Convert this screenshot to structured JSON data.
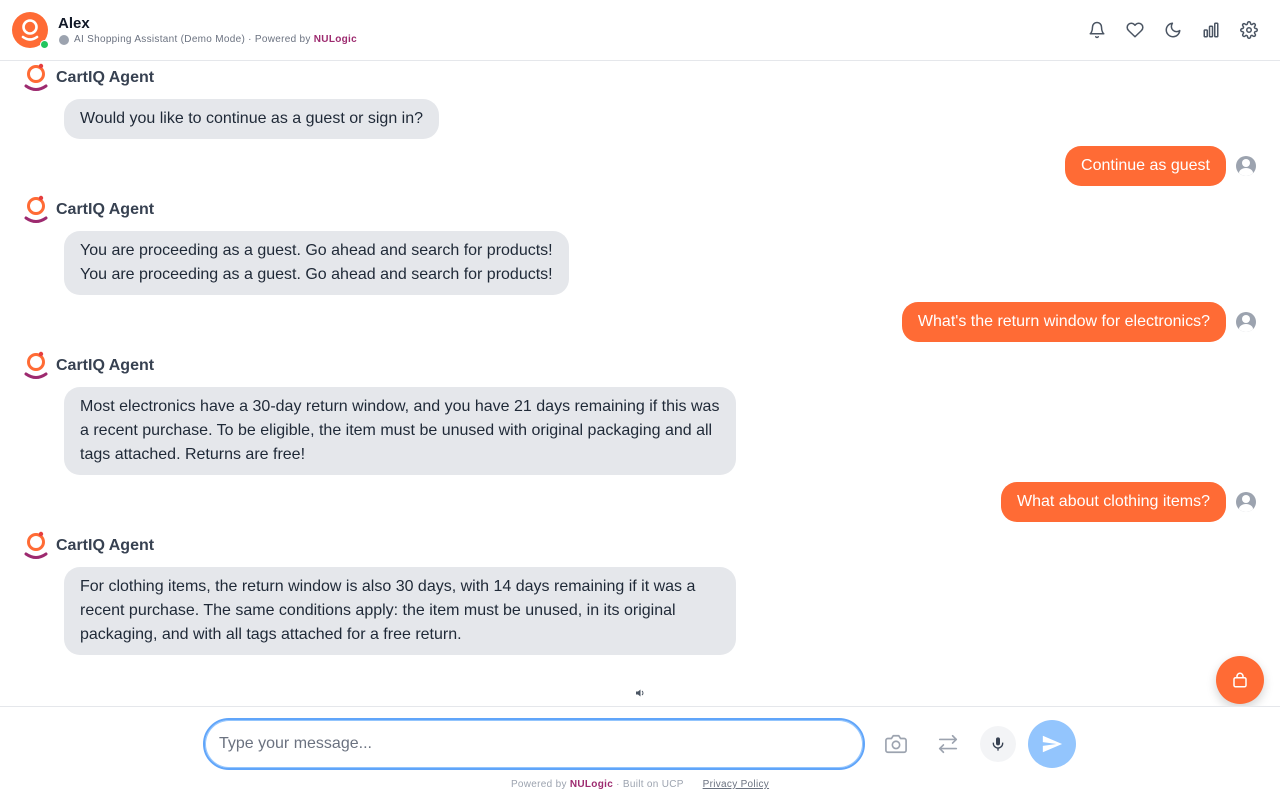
{
  "header": {
    "user_name": "Alex",
    "subtitle_prefix": "AI Shopping Assistant (Demo Mode) · Powered by",
    "brand": "NULogic",
    "icons": [
      "bell-icon",
      "heart-icon",
      "moon-icon",
      "bar-chart-icon",
      "gear-icon"
    ]
  },
  "agent_name": "CartIQ Agent",
  "messages": {
    "agent_1": "Would you like to continue as a guest or sign in?",
    "user_1": "Continue as guest",
    "agent_2_line1": "You are proceeding as a guest. Go ahead and search for products!",
    "agent_2_line2": "You are proceeding as a guest. Go ahead and search for products!",
    "user_2": "What's the return window for electronics?",
    "agent_3": "Most electronics have a 30-day return window, and you have 21 days remaining if this was a recent purchase. To be eligible, the item must be unused with original packaging and all tags attached. Returns are free!",
    "user_3": "What about clothing items?",
    "agent_4": "For clothing items, the return window is also 30 days, with 14 days remaining if it was a recent purchase. The same conditions apply: the item must be unused, in its original packaging, and with all tags attached for a free return."
  },
  "input": {
    "placeholder": "Type your message...",
    "value": ""
  },
  "footer": {
    "powered_prefix": "Powered by",
    "brand": "NULogic",
    "built_on": "· Built on UCP",
    "privacy": "Privacy Policy"
  },
  "colors": {
    "accent": "#ff6b35",
    "brand": "#9d2a6f",
    "agent_bubble": "#e5e7eb",
    "send_button": "#93c5fd"
  }
}
